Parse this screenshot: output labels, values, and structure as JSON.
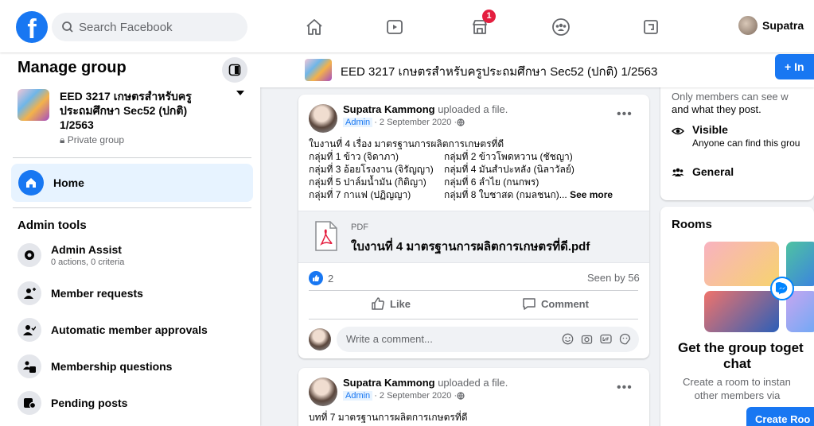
{
  "topbar": {
    "logo": "f",
    "search_placeholder": "Search Facebook",
    "nav_icons": [
      "home-icon",
      "watch-icon",
      "marketplace-icon",
      "groups-icon",
      "gaming-icon"
    ],
    "marketplace_badge": "1",
    "profile_name": "Supatra"
  },
  "sidebar": {
    "title": "Manage group",
    "group_name": "EED 3217 เกษตรสำหรับครูประถมศึกษา Sec52 (ปกติ) 1/2563",
    "group_privacy": "Private group",
    "home_label": "Home",
    "admin_tools_heading": "Admin tools",
    "tools": [
      {
        "label": "Admin Assist",
        "sub": "0 actions, 0 criteria",
        "icon": "admin-assist-icon"
      },
      {
        "label": "Member requests",
        "sub": "",
        "icon": "member-requests-icon"
      },
      {
        "label": "Automatic member approvals",
        "sub": "",
        "icon": "automatic-approvals-icon"
      },
      {
        "label": "Membership questions",
        "sub": "",
        "icon": "membership-questions-icon"
      },
      {
        "label": "Pending posts",
        "sub": "",
        "icon": "pending-posts-icon"
      }
    ]
  },
  "groupbar": {
    "title": "EED 3217 เกษตรสำหรับครูประถมศึกษา Sec52 (ปกติ) 1/2563",
    "invite_label": "+ In"
  },
  "posts": [
    {
      "author": "Supatra Kammong",
      "action": "uploaded a file.",
      "admin_tag": "Admin",
      "date": " · 2 September 2020 · ",
      "lines": [
        {
          "c1": "ใบงานที่ 4 เรื่อง มาตรฐานการผลิตการเกษตรที่ดี",
          "c2": ""
        },
        {
          "c1": "กลุ่มที่ 1 ข้าว (จิดาภา)",
          "c2": "กลุ่มที่ 2 ข้าวโพดหวาน (ชัชญา)"
        },
        {
          "c1": "กลุ่มที่ 3 อ้อยโรงงาน (จิรัญญา)",
          "c2": "กลุ่มที่ 4 มันสำปะหลัง (นิลาวัลย์)"
        },
        {
          "c1": "กลุ่มที่ 5 ปาล์มน้ำมัน (กิติญา)",
          "c2": "กลุ่มที่ 6 ลำไย (กนกพร)"
        },
        {
          "c1": "กลุ่มที่ 7 กาแฟ (ปฏิญญา)",
          "c2": "กลุ่มที่ 8 ใบชาสด (กมลชนก)..."
        }
      ],
      "see_more": "See more",
      "attachment_type": "PDF",
      "attachment_name": "ใบงานที่ 4 มาตรฐานการผลิตการเกษตรที่ดี.pdf",
      "like_count": "2",
      "seen_by": "Seen by 56",
      "like_label": "Like",
      "comment_label": "Comment",
      "comment_placeholder": "Write a comment..."
    },
    {
      "author": "Supatra Kammong",
      "action": "uploaded a file.",
      "admin_tag": "Admin",
      "date": " · 2 September 2020 · ",
      "first_line": "บทที่ 7 มาตรฐานการผลิตการเกษตรที่ดี"
    }
  ],
  "about": {
    "partial_1": "Only members can see w",
    "partial_2": "and what they post.",
    "visible_title": "Visible",
    "visible_desc": "Anyone can find this grou",
    "general_title": "General"
  },
  "rooms": {
    "title": "Rooms",
    "heading_1": "Get the group toget",
    "heading_2": "chat",
    "body_1": "Create a room to instan",
    "body_2": "other members via",
    "button": "Create Roo"
  },
  "colors": {
    "brand": "#1877f2",
    "badge": "#e41e3f",
    "selected_bg": "#e7f3ff"
  }
}
